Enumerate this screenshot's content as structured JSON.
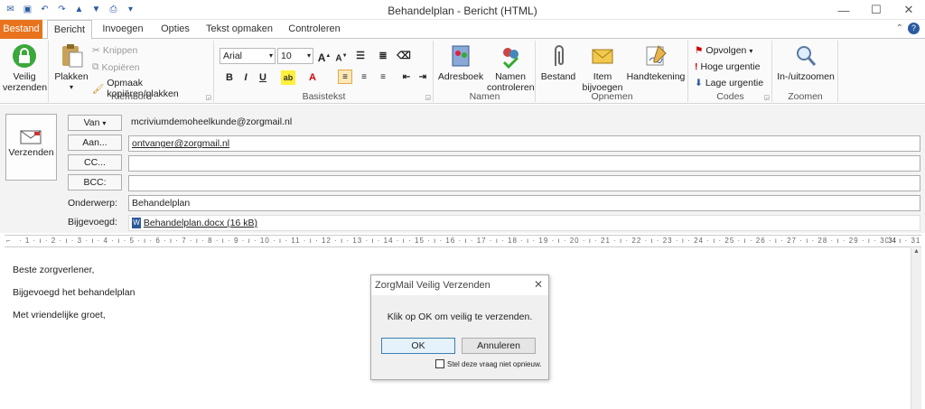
{
  "window": {
    "title": "Behandelplan - Bericht (HTML)"
  },
  "tabs": [
    "Bestand",
    "Bericht",
    "Invoegen",
    "Opties",
    "Tekst opmaken",
    "Controleren"
  ],
  "ribbon": {
    "veilig": {
      "line1": "Veilig",
      "line2": "verzenden"
    },
    "klembord": {
      "label": "Klembord",
      "paste": "Plakken",
      "cut": "Knippen",
      "copy": "Kopiëren",
      "format_painter": "Opmaak kopiëren/plakken"
    },
    "basistekst": {
      "label": "Basistekst",
      "font": "Arial",
      "size": "10"
    },
    "namen": {
      "label": "Namen",
      "adresboek": "Adresboek",
      "controleren_1": "Namen",
      "controleren_2": "controleren"
    },
    "opnemen": {
      "label": "Opnemen",
      "bestand": "Bestand",
      "item_1": "Item",
      "item_2": "bijvoegen",
      "handtekening": "Handtekening"
    },
    "codes": {
      "label": "Codes",
      "opvolgen": "Opvolgen",
      "hoog": "Hoge urgentie",
      "laag": "Lage urgentie"
    },
    "zoomen": {
      "label": "Zoomen",
      "btn": "In-/uitzoomen"
    }
  },
  "header": {
    "send": "Verzenden",
    "van_btn": "Van",
    "van_val": "mcriviumdemoheelkunde@zorgmail.nl",
    "aan_btn": "Aan...",
    "aan_val": "ontvanger@zorgmail.nl",
    "cc_btn": "CC...",
    "bcc_btn": "BCC:",
    "onderwerp_lbl": "Onderwerp:",
    "onderwerp_val": "Behandelplan",
    "bijgevoegd_lbl": "Bijgevoegd:",
    "attachment": "Behandelplan.docx (16 kB)"
  },
  "ruler": {
    "end": "34"
  },
  "message": {
    "line1": "Beste zorgverlener,",
    "line2": "Bijgevoegd het behandelplan",
    "line3": "Met vriendelijke groet,"
  },
  "dialog": {
    "title": "ZorgMail Veilig Verzenden",
    "message": "Klik op OK om veilig te verzenden.",
    "ok": "OK",
    "cancel": "Annuleren",
    "checkbox": "Stel deze vraag niet opnieuw."
  },
  "colors": {
    "file_tab": "#e8731c",
    "accent": "#2c5aa0"
  }
}
